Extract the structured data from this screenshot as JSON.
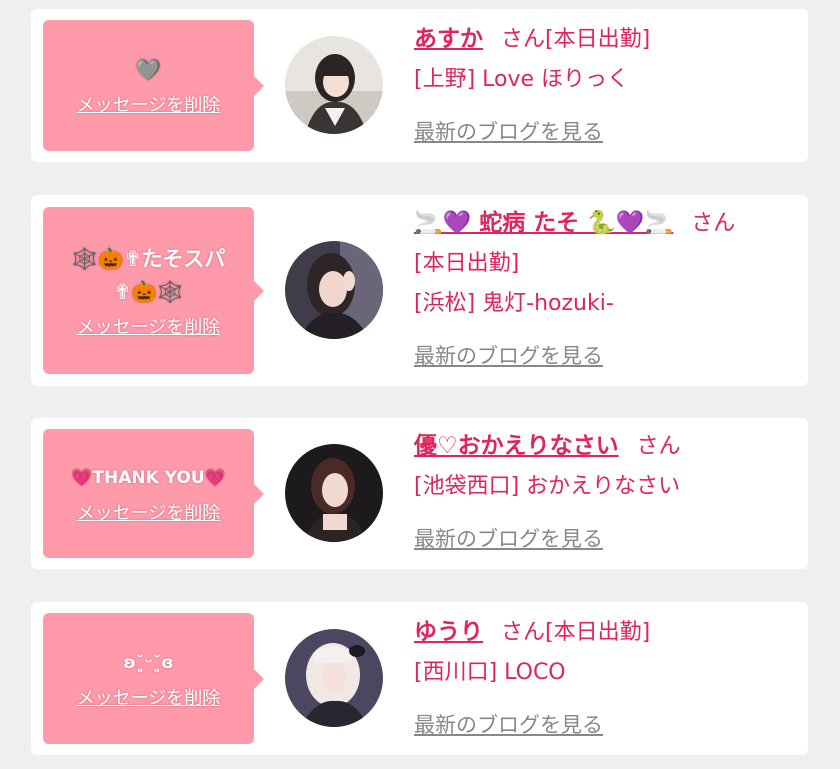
{
  "colors": {
    "accent": "#e0245e",
    "bubble": "#ff9aaa",
    "background": "#efefef",
    "card": "#ffffff",
    "link_gray": "#888888"
  },
  "messages": [
    {
      "message": "🩶",
      "delete_label": "メッセージを削除",
      "name": "あすか",
      "honorific": "さん",
      "status": "[本日出勤]",
      "store": "[上野] Love ほりっく",
      "blog_link": "最新のブログを見る",
      "avatar_icon": "avatar-photo-icon"
    },
    {
      "message": "🕸️🎃✟たそスパ✟🎃🕸️",
      "delete_label": "メッセージを削除",
      "name": "🚬💜 蛇病 たそ 🐍💜🚬",
      "honorific": "さん",
      "status": "[本日出勤]",
      "store": "[浜松] 鬼灯-hozuki-",
      "blog_link": "最新のブログを見る",
      "avatar_icon": "avatar-photo-icon"
    },
    {
      "message": "💗THANK YOU💗",
      "delete_label": "メッセージを削除",
      "name": "優♡おかえりなさい",
      "honorific": "さん",
      "status": "",
      "store": "[池袋西口] おかえりなさい",
      "blog_link": "最新のブログを見る",
      "avatar_icon": "avatar-photo-icon"
    },
    {
      "message": "ʚ˘͈ᵕ˘͈ɞ",
      "delete_label": "メッセージを削除",
      "name": "ゆうり",
      "honorific": "さん",
      "status": "[本日出勤]",
      "store": "[西川口] LOCO",
      "blog_link": "最新のブログを見る",
      "avatar_icon": "avatar-photo-icon"
    }
  ]
}
